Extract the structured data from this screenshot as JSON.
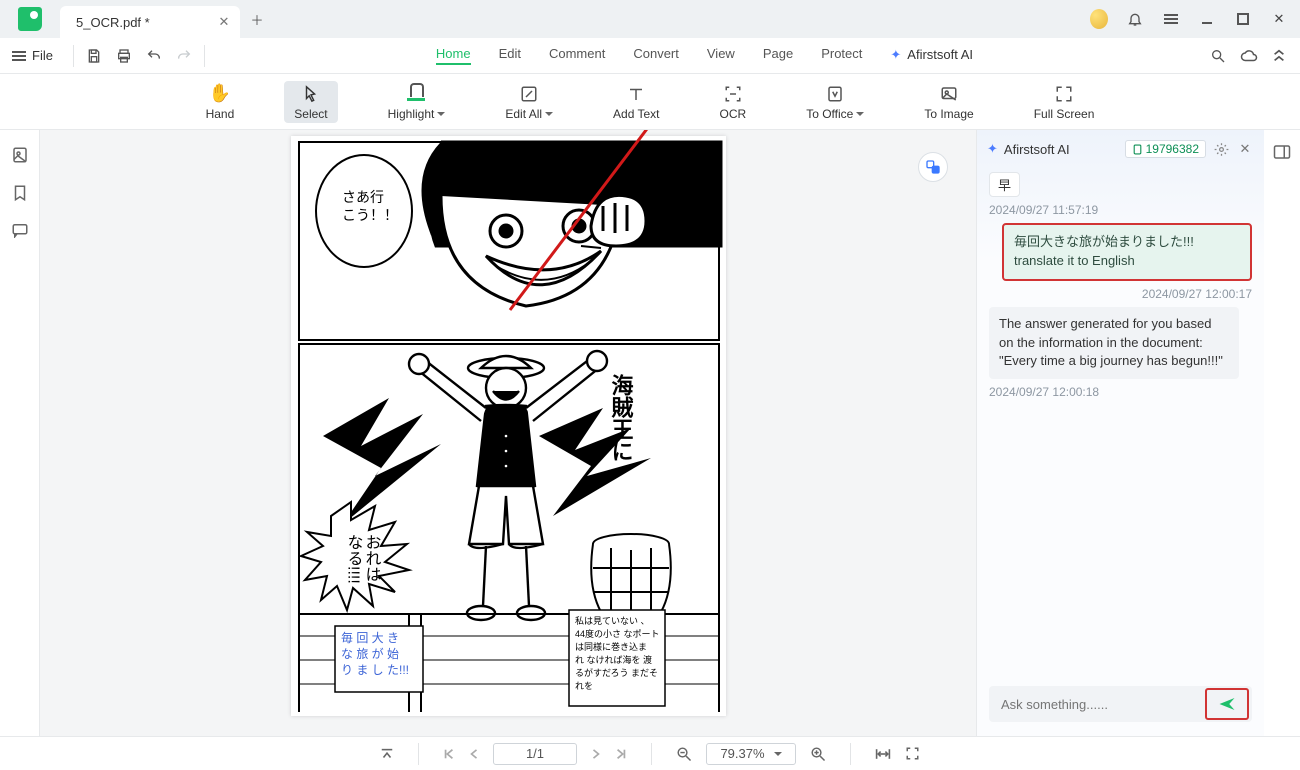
{
  "tab": {
    "title": "5_OCR.pdf *"
  },
  "file_menu": {
    "label": "File"
  },
  "main_menu": {
    "items": [
      "Home",
      "Edit",
      "Comment",
      "Convert",
      "View",
      "Page",
      "Protect"
    ],
    "active": "Home",
    "ai_label": "Afirstsoft AI"
  },
  "ribbon": {
    "hand": "Hand",
    "select": "Select",
    "highlight": "Highlight",
    "edit_all": "Edit All",
    "add_text": "Add Text",
    "ocr": "OCR",
    "to_office": "To Office",
    "to_image": "To Image",
    "full_screen": "Full Screen"
  },
  "document": {
    "speech_go": "さあ行こう！！",
    "speech_become": "おれはなる!!!!",
    "vertical_king": "海賊王に",
    "caption_left": "毎回大きな旅が始りました!!!",
    "caption_right": "私は見ていない 、44度の小さ なポートは同様に巻き込まれ なければ海を 渡るがすだろう まだそれを"
  },
  "ai_panel": {
    "title": "Afirstsoft AI",
    "doc_id": "19796382",
    "quick_msg": "早",
    "ts1": "2024/09/27 11:57:19",
    "user_msg": "毎回大きな旅が始まりました!!!  translate it to English",
    "ts2": "2024/09/27 12:00:17",
    "ai_msg": "The answer generated for you based on the information in the document: \"Every time a big journey has begun!!!\"",
    "ts3": "2024/09/27 12:00:18",
    "placeholder": "Ask something......"
  },
  "status": {
    "page": "1/1",
    "zoom": "79.37%"
  },
  "icons": {
    "search": "search-icon",
    "bell": "bell-icon",
    "menu": "menu-icon",
    "minimize": "minimize-icon",
    "maximize": "maximize-icon",
    "close": "close-icon"
  }
}
